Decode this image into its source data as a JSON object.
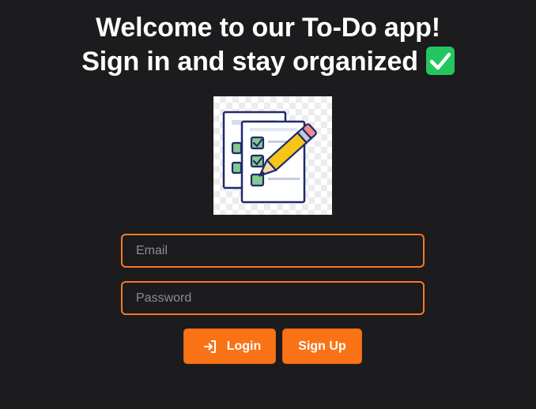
{
  "header": {
    "line1": "Welcome to our To-Do app!",
    "line2": "Sign in and stay organized",
    "emoji_icon": "white-check-mark-icon"
  },
  "hero_image": {
    "icon": "checklist-pencil-illustration"
  },
  "form": {
    "email_placeholder": "Email",
    "email_value": "",
    "password_placeholder": "Password",
    "password_value": ""
  },
  "buttons": {
    "login_label": "Login",
    "login_icon": "sign-in-icon",
    "signup_label": "Sign Up"
  },
  "colors": {
    "background": "#1c1b1d",
    "accent": "#f97316",
    "border": "#f5782a",
    "check_green": "#22c55e"
  }
}
